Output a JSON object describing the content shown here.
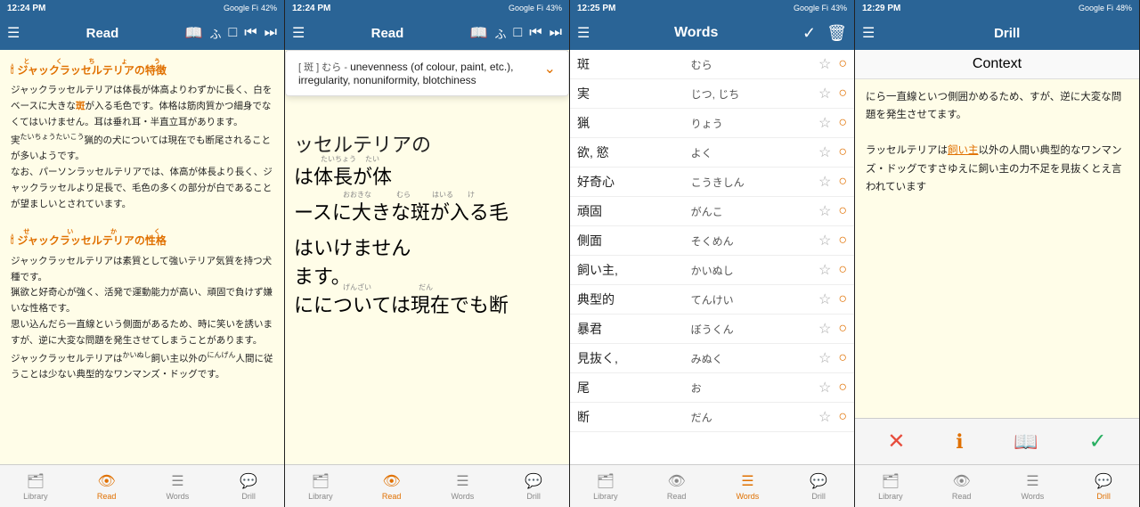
{
  "panels": [
    {
      "id": "panel1",
      "status": {
        "time": "12:24 PM",
        "battery": "42%",
        "signal": "Google Fi"
      },
      "nav": {
        "title": "Read",
        "icons": [
          "menu",
          "book",
          "fu",
          "square",
          "back",
          "forward"
        ]
      },
      "content_type": "reading",
      "sections": [
        {
          "title": "ジャックラッセルテリアの特徴",
          "body": "ジャックラッセルテリアは体長が体高よりわずかに長く、白をベースに大きな斑が入る毛色です。体格は筋肉質かつ細身でなくてはいけません。耳は垂れ耳・半直立耳があります。\n実猟的の犬についてあ現在でも断尾されることが多いようです。\nなお、パーソンラッセルテリアでは、体高が体長より長く、ジャックラッセルより足長で、毛色の多くの部分が白であることが望ましいとされています。"
        },
        {
          "title": "ジャックラッセルテリアの性格",
          "body": "ジャックラッセルテリアは素質として強いテリア気質を持つ犬種です。\n猟欲と好奇心が強く、活発で運動能力が高い、頑固で負けず嫌いな性格です。\n思い込んだら一直線という側面があるため、時に笑いを誘いますが、逆に大変な問題を発生させてしまうことがあります。\nジャックラッセルテリアは飼い主以外の人間に従うことは少ない典型的なワンマンズ・ドッグです。"
        }
      ],
      "tabs": [
        "Library",
        "Read",
        "Words",
        "Drill"
      ],
      "active_tab": "Read"
    },
    {
      "id": "panel2",
      "status": {
        "time": "12:24 PM",
        "battery": "43%",
        "signal": "Google Fi"
      },
      "nav": {
        "title": "Read",
        "icons": [
          "menu",
          "book",
          "fu",
          "square",
          "back",
          "forward"
        ]
      },
      "content_type": "reading_with_popup",
      "popup": {
        "bracket_word": "斑",
        "reading": "むら",
        "definition": "unevenness (of colour, paint, etc.), irregularity, nonuniformity, blotchiness"
      },
      "big_text_lines": [
        "ッセルテリアの",
        "は体長が体",
        "ースに大きな斑が入る毛",
        "はいけません",
        "ます。",
        "にについては現在でも断"
      ],
      "tabs": [
        "Library",
        "Read",
        "Words",
        "Drill"
      ],
      "active_tab": "Read"
    },
    {
      "id": "panel3",
      "status": {
        "time": "12:25 PM",
        "battery": "43%",
        "signal": "Google Fi"
      },
      "nav": {
        "title": "Words",
        "left_icon": "menu",
        "right_icons": [
          "checkmark",
          "trash"
        ]
      },
      "content_type": "words",
      "words": [
        {
          "kanji": "斑",
          "reading": "むら"
        },
        {
          "kanji": "実",
          "reading": "じつ, じち"
        },
        {
          "kanji": "猟",
          "reading": "りょう"
        },
        {
          "kanji": "欲, 慾",
          "reading": "よく"
        },
        {
          "kanji": "好奇心",
          "reading": "こうきしん"
        },
        {
          "kanji": "頑固",
          "reading": "がんこ"
        },
        {
          "kanji": "側面",
          "reading": "そくめん"
        },
        {
          "kanji": "飼い主,",
          "reading": "かいぬし"
        },
        {
          "kanji": "典型的",
          "reading": "てんけい"
        },
        {
          "kanji": "暴君",
          "reading": "ぼうくん"
        },
        {
          "kanji": "見抜く,",
          "reading": "みぬく"
        },
        {
          "kanji": "尾",
          "reading": "お"
        },
        {
          "kanji": "断",
          "reading": "だん"
        }
      ],
      "tabs": [
        "Library",
        "Read",
        "Words",
        "Drill"
      ],
      "active_tab": "Words"
    },
    {
      "id": "panel4",
      "status": {
        "time": "12:29 PM",
        "battery": "48%",
        "signal": "Google Fi"
      },
      "nav": {
        "title": "Drill",
        "left_icon": "menu"
      },
      "content_type": "drill",
      "context_label": "Context",
      "drill_text": "にら一直線といつ側囲かめるため、すが、逆に大変な問題を発生させてます。\n\nラッセルテリアは飼い主以外の人間い典型的なワンマンズ・ドッグですさゆえに飼い主の力不足を見抜くとえ言われています",
      "highlighted_phrase": "飼い主",
      "underline_phrase": "飼い主",
      "drill_buttons": [
        "✕",
        "ℹ",
        "book",
        "✓"
      ],
      "tabs": [
        "Library",
        "Read",
        "Words",
        "Drill"
      ],
      "active_tab": "Drill"
    }
  ],
  "icons": {
    "menu": "☰",
    "book": "📖",
    "fu": "ふ",
    "square": "□",
    "back": "⏮",
    "forward": "⏭",
    "library": "🗂",
    "read": "👁",
    "words": "☰",
    "drill": "💬",
    "star_empty": "☆",
    "circle": "○",
    "checkmark_circle": "✓",
    "trash": "🗑",
    "chevron_down": "⌄",
    "flame": "🕯"
  },
  "colors": {
    "nav_bg": "#2a6496",
    "nav_text": "#ffffff",
    "content_bg": "#fffde8",
    "highlight_orange": "#e07000",
    "tab_active": "#e07000",
    "tab_inactive": "#888888"
  }
}
